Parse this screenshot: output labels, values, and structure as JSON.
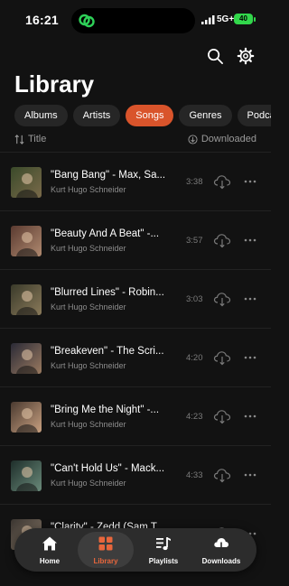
{
  "status_bar": {
    "time": "16:21",
    "network": "5G+",
    "battery": "40"
  },
  "header": {
    "title": "Library"
  },
  "tabs": [
    {
      "label": "Albums"
    },
    {
      "label": "Artists"
    },
    {
      "label": "Songs"
    },
    {
      "label": "Genres"
    },
    {
      "label": "Podcasts"
    }
  ],
  "active_tab": "Songs",
  "sort": {
    "label": "Title",
    "filter_label": "Downloaded"
  },
  "songs": [
    {
      "title": "\"Bang Bang\" - Max, Sa...",
      "artist": "Kurt Hugo Schneider",
      "duration": "3:38"
    },
    {
      "title": "\"Beauty And A Beat\" -...",
      "artist": "Kurt Hugo Schneider",
      "duration": "3:57"
    },
    {
      "title": "\"Blurred Lines\" - Robin...",
      "artist": "Kurt Hugo Schneider",
      "duration": "3:03"
    },
    {
      "title": "\"Breakeven\" - The Scri...",
      "artist": "Kurt Hugo Schneider",
      "duration": "4:20"
    },
    {
      "title": "\"Bring Me the Night\" -...",
      "artist": "Kurt Hugo Schneider",
      "duration": "4:23"
    },
    {
      "title": "\"Can't Hold Us\" - Mack...",
      "artist": "Kurt Hugo Schneider",
      "duration": "4:33"
    },
    {
      "title": "\"Clarity\" - Zedd (Sam T...",
      "artist": "",
      "duration": ""
    }
  ],
  "nav": [
    {
      "label": "Home",
      "icon": "home-icon"
    },
    {
      "label": "Library",
      "icon": "library-icon"
    },
    {
      "label": "Playlists",
      "icon": "playlists-icon"
    },
    {
      "label": "Downloads",
      "icon": "downloads-icon"
    }
  ],
  "colors": {
    "accent": "#d9542b",
    "accent_text": "#e8663c",
    "background": "#121212",
    "battery": "#32d74b"
  }
}
